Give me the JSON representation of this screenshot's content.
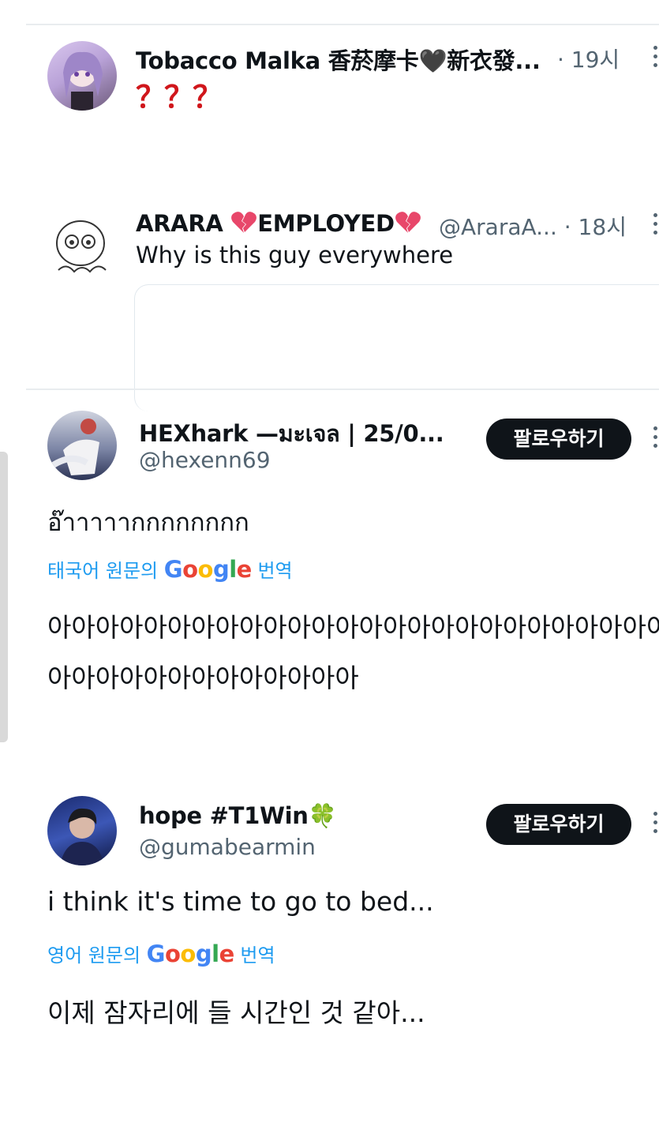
{
  "posts": [
    {
      "display_name": "Tobacco Malka 香菸摩卡🖤新衣發...",
      "meta": "· 19시",
      "text": "？？？"
    },
    {
      "display_name_parts": [
        "ARARA ",
        "EMPLOYED",
        ""
      ],
      "handle_meta": "@AraraA... · 18시",
      "text": "Why is this guy everywhere"
    },
    {
      "display_name": "HEXhark —มะเจล | 25/0...",
      "handle": "@hexenn69",
      "follow_label": "팔로우하기",
      "text": "อ๊าาาาากกกกกกกก",
      "translate_prefix": "태국어 원문의",
      "translate_suffix": "번역",
      "translation_line1": "아아아아아아아아아아아아아아아아아아아아아아아아아아",
      "translation_line2": "아아아아아아아아아아아아아"
    },
    {
      "display_name": "hope #T1Win🍀",
      "handle": "@gumabearmin",
      "follow_label": "팔로우하기",
      "text": "i think it's time to go to bed...",
      "translate_prefix": "영어 원문의",
      "translate_suffix": "번역",
      "translation": "이제 잠자리에 들 시간인 것 같아..."
    }
  ],
  "google_logo": {
    "text": "Google",
    "letters": [
      "G",
      "o",
      "o",
      "g",
      "l",
      "e"
    ],
    "colors": [
      "#4285F4",
      "#EA4335",
      "#FBBC05",
      "#4285F4",
      "#34A853",
      "#EA4335"
    ]
  },
  "colors": {
    "translate_link": "#1d9bf0",
    "question_marks": "#d0161b",
    "follow_button": "#0f1419"
  }
}
